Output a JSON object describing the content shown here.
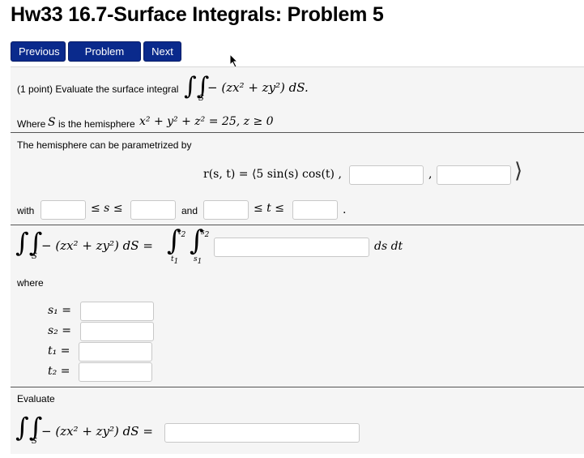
{
  "page": {
    "title": "Hw33 16.7-Surface Integrals: Problem 5"
  },
  "nav": {
    "previous": "Previous",
    "problem_list": "Problem List",
    "next": "Next"
  },
  "problem": {
    "points": "(1 point) Evaluate the surface integral",
    "integrand": "− (zx² + zy²)  dS.",
    "where_prefix": "Where",
    "where_var": "S",
    "where_mid": "is the hemisphere",
    "surface_eq": "x² + y² + z² = 25,  z ≥ 0",
    "param_text": "The hemisphere can be parametrized by",
    "r_lhs": "r(s, t) = ⟨5 sin(s) cos(t) ,",
    "comma": ",",
    "r_close": "⟩",
    "with_label": "with",
    "s_ineq": "≤ s ≤",
    "and_label": "and",
    "t_ineq": "≤ t ≤",
    "period": ".",
    "integral_eq_lhs": "− (zx² + zy²)  dS =",
    "ds_dt": "ds dt",
    "where_label": "where",
    "s1": "s₁ =",
    "s2": "s₂ =",
    "t1": "t₁ =",
    "t2": "t₂ =",
    "evaluate_label": "Evaluate",
    "evaluate_lhs": "− (zx² + zy²)  dS ="
  }
}
